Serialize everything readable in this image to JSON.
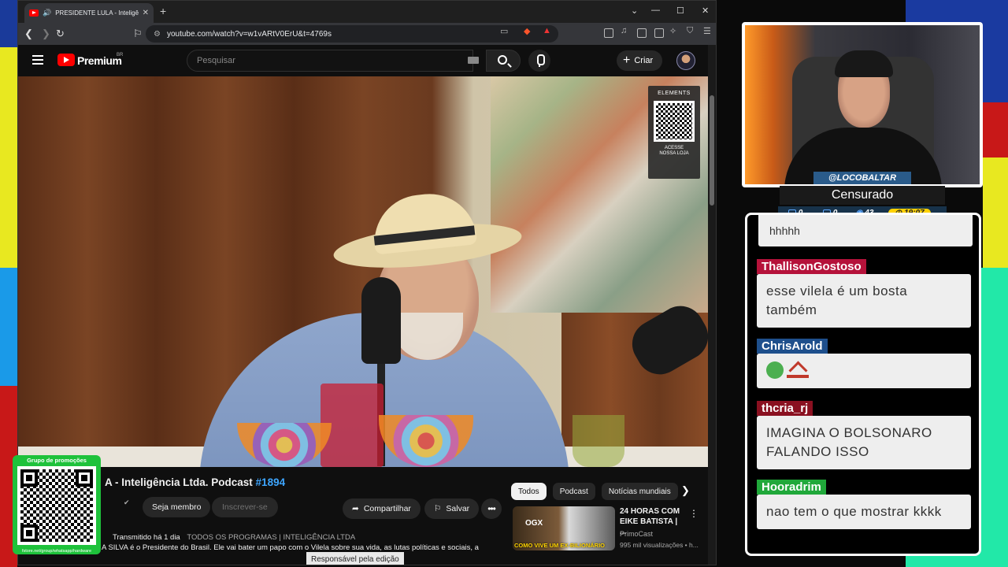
{
  "browser": {
    "tab_title": "PRESIDENTE LULA - Inteligência Ltda",
    "url": "youtube.com/watch?v=w1vARtV0ErU&t=4769s",
    "status_text": "Responsável pela edição"
  },
  "youtube": {
    "logo": "Premium",
    "region": "BR",
    "search_placeholder": "Pesquisar",
    "create_label": "Criar",
    "video_title_prefix": "Lula A - Inteligência Ltda. Podcast",
    "video_title_visible": "A - Inteligência Ltda. Podcast",
    "episode": "#1894",
    "member_label": "Seja membro",
    "subscribe_label": "Inscrever-se",
    "share_label": "Compartilhar",
    "save_label": "Salvar",
    "more_label": "•••",
    "stream_info": "Transmitido há 1 dia",
    "tags": "TODOS OS PROGRAMAS | INTELIGÊNCIA LTDA",
    "description": "A SILVA é o Presidente do Brasil. Ele vai bater um papo com o Vilela sobre sua vida, as lutas políticas e sociais, a",
    "chips": [
      "Todos",
      "Podcast",
      "Notícias mundiais"
    ],
    "recommendation": {
      "thumb_brand": "OGX",
      "thumb_text": "COMO VIVE UM EX-BILIONÁRIO",
      "title": "24 HORAS COM EIKE BATISTA | ...",
      "channel": "PrimoCast",
      "stats": "995 mil visualizações • h..."
    },
    "elements_badge": {
      "title": "ELEMENTS",
      "caption": "ACESSE NOSSA LOJA"
    }
  },
  "overlay": {
    "promo_title": "Grupo de promoções",
    "promo_url": "fstore.net/group/whatsapp/hardware",
    "handle": "@LOCOBALTAR",
    "status": "Censurado",
    "stats": {
      "a": "0",
      "b": "0",
      "viewers": "43",
      "time": "19:07"
    }
  },
  "chat": {
    "previous_text": "hhhhh",
    "messages": [
      {
        "user": "ThallisonGostoso",
        "text": "esse vilela é um bosta também",
        "color": "#b5123a"
      },
      {
        "user": "ChrisArold",
        "text": "",
        "color": "#1e4f8c"
      },
      {
        "user": "thcria_rj",
        "text": "IMAGINA O BOLSONARO FALANDO ISSO",
        "color": "#8a1020"
      },
      {
        "user": "Hooradrim",
        "text": "nao tem o que mostrar kkkk",
        "color": "#20a83a"
      }
    ]
  }
}
